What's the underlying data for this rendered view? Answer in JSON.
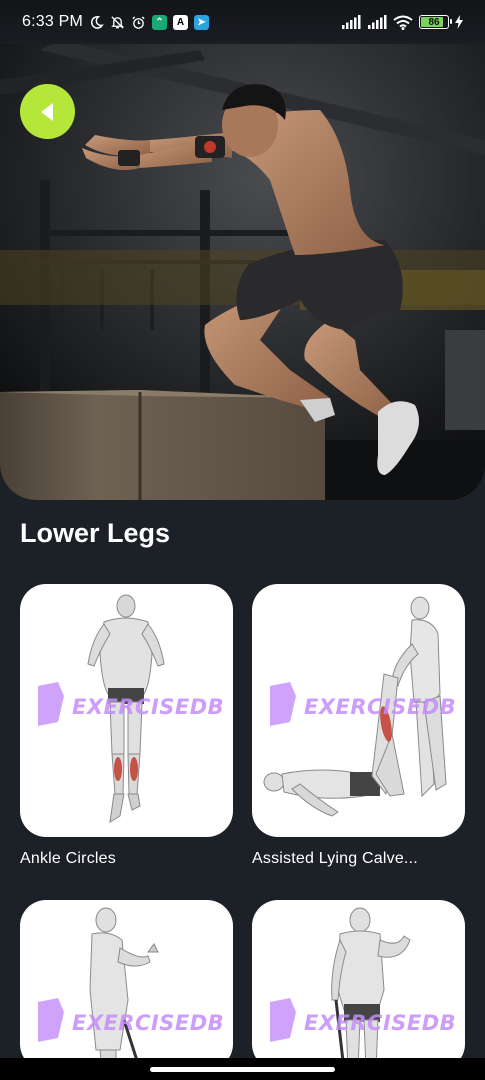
{
  "status_bar": {
    "time": "6:33 PM",
    "battery": "86",
    "battery_level": 0.86,
    "icons": [
      "moon-icon",
      "bell-off-icon",
      "alarm-icon",
      "app-icon",
      "app-icon",
      "telegram-icon",
      "signal-icon",
      "signal-icon",
      "wifi-icon",
      "battery-icon",
      "charging-icon"
    ]
  },
  "hero": {
    "image": "athlete-box-jump-photo"
  },
  "section": {
    "title": "Lower Legs"
  },
  "exercises": [
    {
      "name": "Ankle Circles",
      "watermark": "EXERCISEDB"
    },
    {
      "name": "Assisted Lying Calve...",
      "watermark": "EXERCISEDB"
    },
    {
      "name": "",
      "watermark": "EXERCISEDB"
    },
    {
      "name": "",
      "watermark": "EXERCISEDB"
    }
  ],
  "colors": {
    "background": "#1c2127",
    "back_button": "#b5e73a",
    "watermark": "#c48cfa",
    "highlight_muscle": "#c0392b"
  }
}
